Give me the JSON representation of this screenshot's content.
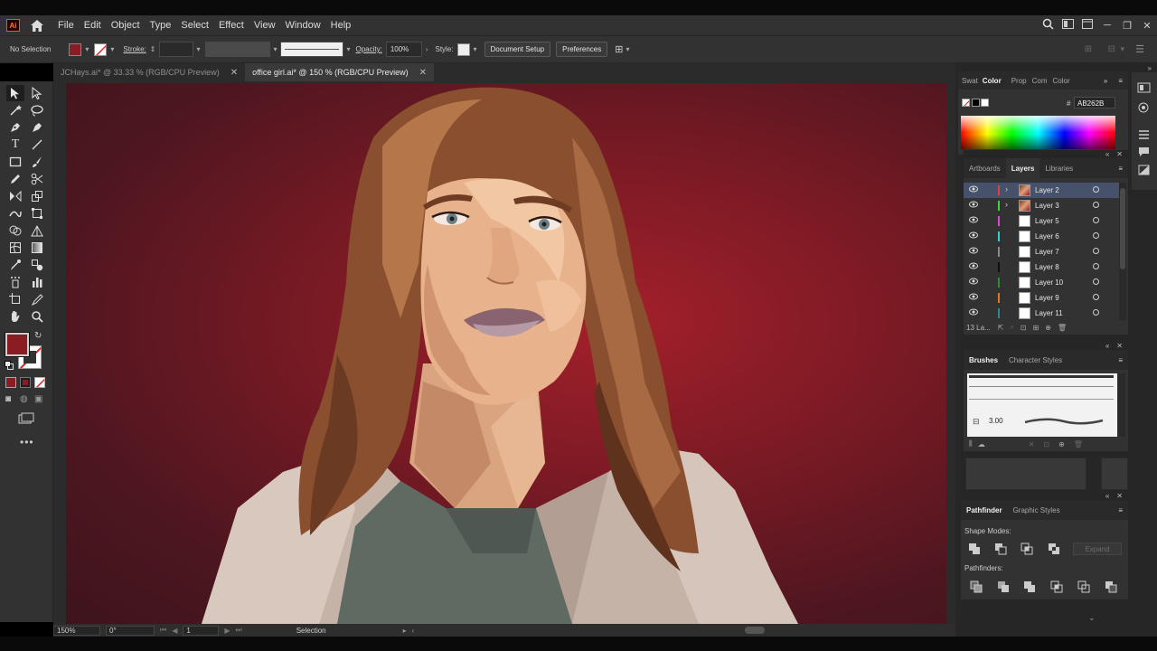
{
  "menu": {
    "app_logo": "Ai",
    "items": [
      "File",
      "Edit",
      "Object",
      "Type",
      "Select",
      "Effect",
      "View",
      "Window",
      "Help"
    ]
  },
  "control_bar": {
    "selection": "No Selection",
    "stroke_label": "Stroke:",
    "opacity_label": "Opacity:",
    "opacity_value": "100%",
    "style_label": "Style:",
    "document_setup": "Document Setup",
    "preferences": "Preferences",
    "fill_color": "#8b1c24"
  },
  "tabs": [
    {
      "label": "JCHays.ai* @ 33.33 % (RGB/CPU Preview)",
      "active": false
    },
    {
      "label": "office girl.ai* @ 150 % (RGB/CPU Preview)",
      "active": true
    }
  ],
  "color_panel": {
    "tabs": [
      "Swat",
      "Color",
      "Prop",
      "Com",
      "Color"
    ],
    "active_tab": "Color",
    "hex_label": "#",
    "hex_value": "AB262B"
  },
  "layers_panel": {
    "tabs": [
      "Artboards",
      "Layers",
      "Libraries"
    ],
    "active_tab": "Layers",
    "layers": [
      {
        "name": "Layer 2",
        "color": "#e04040",
        "selected": true,
        "expandable": true
      },
      {
        "name": "Layer 3",
        "color": "#3fd23f",
        "selected": false,
        "expandable": true
      },
      {
        "name": "Layer 5",
        "color": "#d34ad3",
        "selected": false,
        "expandable": false
      },
      {
        "name": "Layer 6",
        "color": "#35d0d6",
        "selected": false,
        "expandable": false
      },
      {
        "name": "Layer 7",
        "color": "#8a8a8a",
        "selected": false,
        "expandable": false
      },
      {
        "name": "Layer 8",
        "color": "#111111",
        "selected": false,
        "expandable": false
      },
      {
        "name": "Layer 10",
        "color": "#2f8f2f",
        "selected": false,
        "expandable": false
      },
      {
        "name": "Layer 9",
        "color": "#e07a20",
        "selected": false,
        "expandable": false
      },
      {
        "name": "Layer 11",
        "color": "#2a8a8a",
        "selected": false,
        "expandable": false
      }
    ],
    "count": "13 La..."
  },
  "brushes_panel": {
    "tabs": [
      "Brushes",
      "Character Styles"
    ],
    "active_tab": "Brushes",
    "brush_size": "3.00"
  },
  "pathfinder_panel": {
    "tabs": [
      "Pathfinder",
      "Graphic Styles"
    ],
    "active_tab": "Pathfinder",
    "shape_modes": "Shape Modes:",
    "expand": "Expand",
    "pathfinders": "Pathfinders:"
  },
  "status": {
    "zoom": "150%",
    "rotation": "0°",
    "artboard": "1",
    "tool": "Selection"
  }
}
